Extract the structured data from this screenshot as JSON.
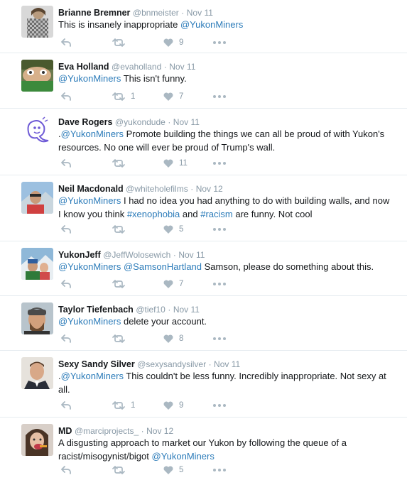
{
  "tweets": [
    {
      "name": "Brianne Bremner",
      "handle": "@bnmeister",
      "sep": "·",
      "time": "Nov 11",
      "text": [
        {
          "t": "This is insanely inappropriate "
        },
        {
          "t": "@YukonMiners",
          "link": true
        }
      ],
      "retweets": "",
      "likes": "9"
    },
    {
      "name": "Eva Holland",
      "handle": "@evaholland",
      "sep": "·",
      "time": "Nov 11",
      "text": [
        {
          "t": "@YukonMiners",
          "link": true
        },
        {
          "t": " This isn't funny."
        }
      ],
      "retweets": "1",
      "likes": "7"
    },
    {
      "name": "Dave Rogers",
      "handle": "@yukondude",
      "sep": "·",
      "time": "Nov 11",
      "text": [
        {
          "t": "."
        },
        {
          "t": "@YukonMiners",
          "link": true
        },
        {
          "t": " Promote building the things we can all be proud of with Yukon's resources. No one will ever be proud of Trump's wall."
        }
      ],
      "retweets": "",
      "likes": "11"
    },
    {
      "name": "Neil Macdonald",
      "handle": "@whiteholefilms",
      "sep": "·",
      "time": "Nov 12",
      "text": [
        {
          "t": "@YukonMiners",
          "link": true
        },
        {
          "t": " I had no idea you had anything to do with building walls, and now I know you think "
        },
        {
          "t": "#xenophobia",
          "link": true
        },
        {
          "t": " and "
        },
        {
          "t": "#racism",
          "link": true
        },
        {
          "t": " are funny. Not cool"
        }
      ],
      "retweets": "",
      "likes": "5"
    },
    {
      "name": "YukonJeff",
      "handle": "@JeffWolosewich",
      "sep": "·",
      "time": "Nov 11",
      "text": [
        {
          "t": "@YukonMiners",
          "link": true
        },
        {
          "t": " "
        },
        {
          "t": "@SamsonHartland",
          "link": true
        },
        {
          "t": " Samson, please do something about this."
        }
      ],
      "retweets": "",
      "likes": "7"
    },
    {
      "name": "Taylor Tiefenbach",
      "handle": "@tief10",
      "sep": "·",
      "time": "Nov 11",
      "text": [
        {
          "t": "@YukonMiners",
          "link": true
        },
        {
          "t": " delete your account."
        }
      ],
      "retweets": "",
      "likes": "8"
    },
    {
      "name": "Sexy Sandy Silver",
      "handle": "@sexysandysilver",
      "sep": "·",
      "time": "Nov 11",
      "text": [
        {
          "t": "."
        },
        {
          "t": "@YukonMiners",
          "link": true
        },
        {
          "t": " This couldn't be less funny. Incredibly inappropriate. Not sexy at all."
        }
      ],
      "retweets": "1",
      "likes": "9"
    },
    {
      "name": "MD",
      "handle": "@marciprojects_",
      "sep": "·",
      "time": "Nov 12",
      "text": [
        {
          "t": "A disgusting approach to market our Yukon by following the queue of a racist/misogynist/bigot  "
        },
        {
          "t": "@YukonMiners",
          "link": true
        }
      ],
      "retweets": "",
      "likes": "5"
    }
  ]
}
